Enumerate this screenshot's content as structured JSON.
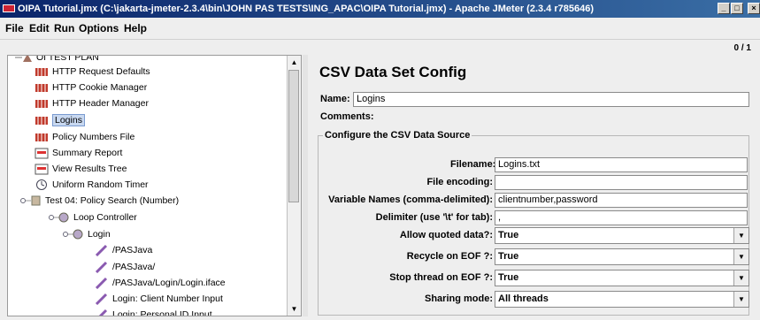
{
  "window": {
    "title": "OIPA Tutorial.jmx (C:\\jakarta-jmeter-2.3.4\\bin\\JOHN PAS TESTS\\ING_APAC\\OIPA Tutorial.jmx) - Apache JMeter (2.3.4 r785646)"
  },
  "menu": [
    "File",
    "Edit",
    "Run",
    "Options",
    "Help"
  ],
  "counter": "0 / 1",
  "tree": {
    "items": [
      {
        "label": "OI TEST PLAN",
        "icon": "test-plan-icon"
      },
      {
        "label": "HTTP Request Defaults",
        "icon": "config-element-icon"
      },
      {
        "label": "HTTP Cookie Manager",
        "icon": "config-element-icon"
      },
      {
        "label": "HTTP Header Manager",
        "icon": "config-element-icon"
      },
      {
        "label": "Logins",
        "icon": "config-element-icon",
        "selected": true
      },
      {
        "label": "Policy Numbers File",
        "icon": "config-element-icon"
      },
      {
        "label": "Summary Report",
        "icon": "listener-icon"
      },
      {
        "label": "View Results Tree",
        "icon": "listener-icon"
      },
      {
        "label": "Uniform Random Timer",
        "icon": "timer-icon"
      },
      {
        "label": "Test 04: Policy Search (Number)",
        "icon": "thread-group-icon"
      },
      {
        "label": "Loop Controller",
        "icon": "controller-icon"
      },
      {
        "label": "Login",
        "icon": "controller-icon"
      },
      {
        "label": "/PASJava",
        "icon": "sampler-icon"
      },
      {
        "label": "/PASJava/",
        "icon": "sampler-icon"
      },
      {
        "label": "/PASJava/Login/Login.iface",
        "icon": "sampler-icon"
      },
      {
        "label": "Login: Client Number Input",
        "icon": "sampler-icon"
      },
      {
        "label": "Login: Personal ID Input",
        "icon": "sampler-icon"
      }
    ]
  },
  "config": {
    "title": "CSV Data Set Config",
    "name_label": "Name:",
    "name_value": "Logins",
    "comments_label": "Comments:",
    "group_title": "Configure the CSV Data Source",
    "fields": [
      {
        "label": "Filename:",
        "value": "Logins.txt"
      },
      {
        "label": "File encoding:",
        "value": ""
      },
      {
        "label": "Variable Names (comma-delimited):",
        "value": "clientnumber,password"
      },
      {
        "label": "Delimiter (use '\\t' for tab):",
        "value": ","
      }
    ],
    "selects": [
      {
        "label": "Allow quoted data?:",
        "value": "True"
      },
      {
        "label": "Recycle on EOF ?:",
        "value": "True"
      },
      {
        "label": "Stop thread on EOF ?:",
        "value": "True"
      },
      {
        "label": "Sharing mode:",
        "value": "All threads"
      }
    ]
  }
}
